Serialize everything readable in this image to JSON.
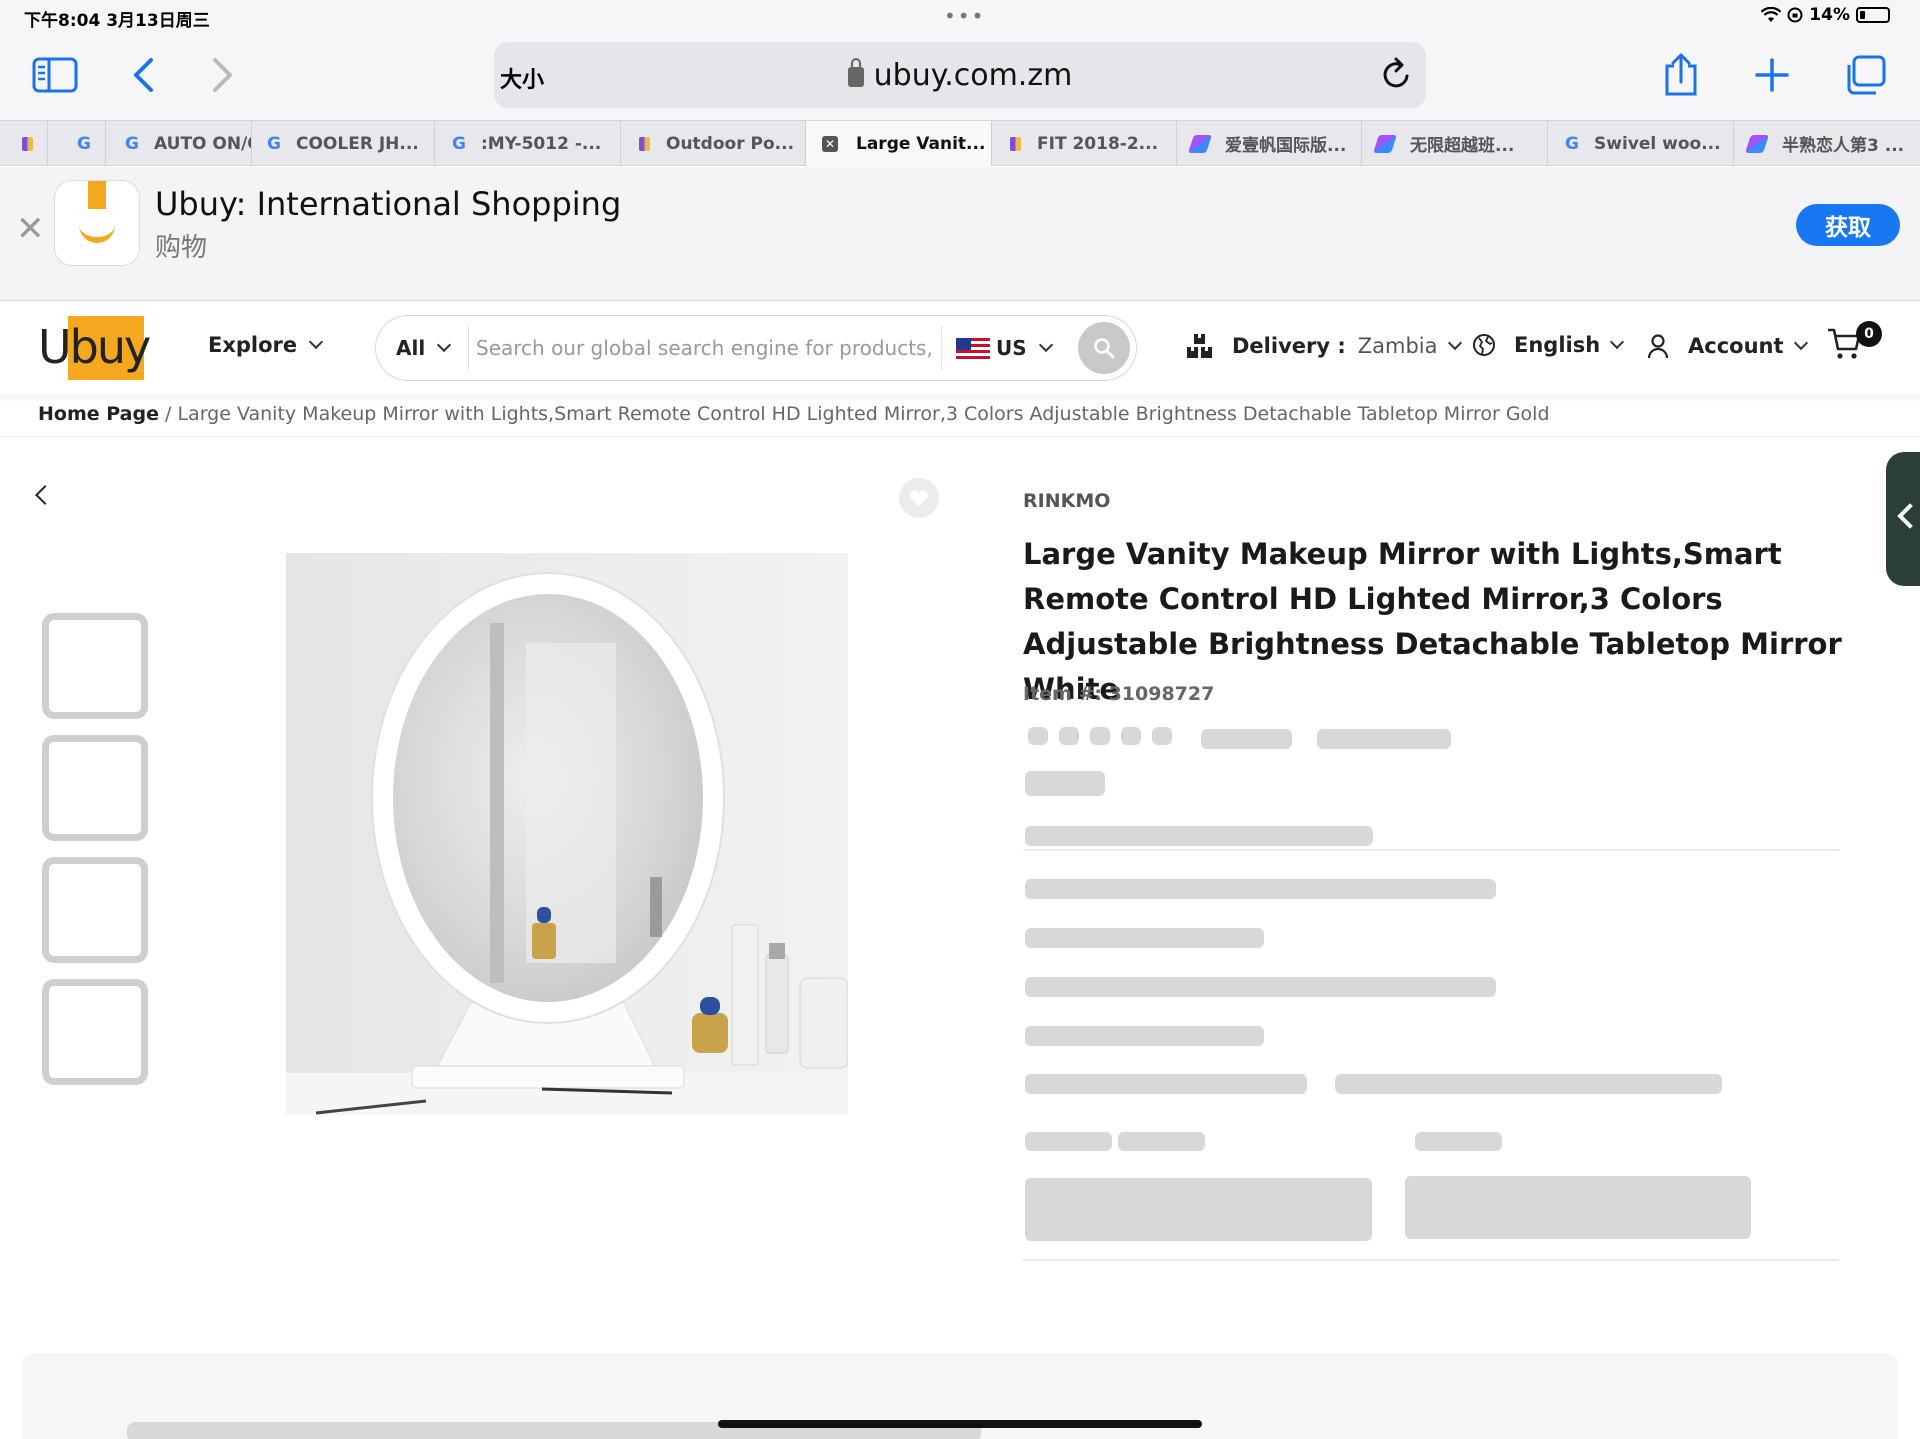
{
  "status_bar": {
    "time": "下午8:04   3月13日周三",
    "dots": "•••",
    "battery": "14%"
  },
  "browser": {
    "text_size_label": "大小",
    "url": "ubuy.com.zm",
    "tabs": [
      {
        "label": "",
        "icon": "g-icon"
      },
      {
        "label": "AUTO ON/O",
        "icon": "g-icon"
      },
      {
        "label": "COOLER JH...",
        "icon": "g-icon"
      },
      {
        "label": ":MY-5012 -...",
        "icon": "g-icon"
      },
      {
        "label": "Outdoor Po...",
        "icon": "bag-icon"
      },
      {
        "label": "Large Vanit...",
        "icon": "close-icon",
        "active": true
      },
      {
        "label": "FIT 2018-2...",
        "icon": "bag-icon"
      },
      {
        "label": "爱壹帆国际版...",
        "icon": "kite-icon"
      },
      {
        "label": "无限超越班...",
        "icon": "kite-icon"
      },
      {
        "label": "Swivel woo...",
        "icon": "g-icon"
      },
      {
        "label": "半熟恋人第3 ...",
        "icon": "kite-icon"
      }
    ]
  },
  "app_banner": {
    "title": "Ubuy: International Shopping",
    "subtitle": "购物",
    "get_label": "获取"
  },
  "header": {
    "logo_text": "Ubuy",
    "explore_label": "Explore",
    "search_category": "All",
    "search_placeholder": "Search our global search engine for products,",
    "store_region": "US",
    "delivery_label": "Delivery :",
    "delivery_country": "Zambia",
    "language": "English",
    "account_label": "Account",
    "cart_count": "0"
  },
  "breadcrumb": {
    "home": "Home Page",
    "separator": " / ",
    "current": "Large Vanity Makeup Mirror with Lights,Smart Remote Control HD Lighted Mirror,3 Colors Adjustable Brightness Detachable Tabletop Mirror Gold"
  },
  "product": {
    "brand": "RINKMO",
    "title": "Large Vanity Makeup Mirror with Lights,Smart Remote Control HD Lighted Mirror,3 Colors Adjustable Brightness Detachable Tabletop Mirror White",
    "item_number": "Item #: 31098727"
  },
  "colors": {
    "brand_orange": "#f4a81f",
    "skeleton": "#d8d8d8",
    "get_button": "#1877f2"
  }
}
